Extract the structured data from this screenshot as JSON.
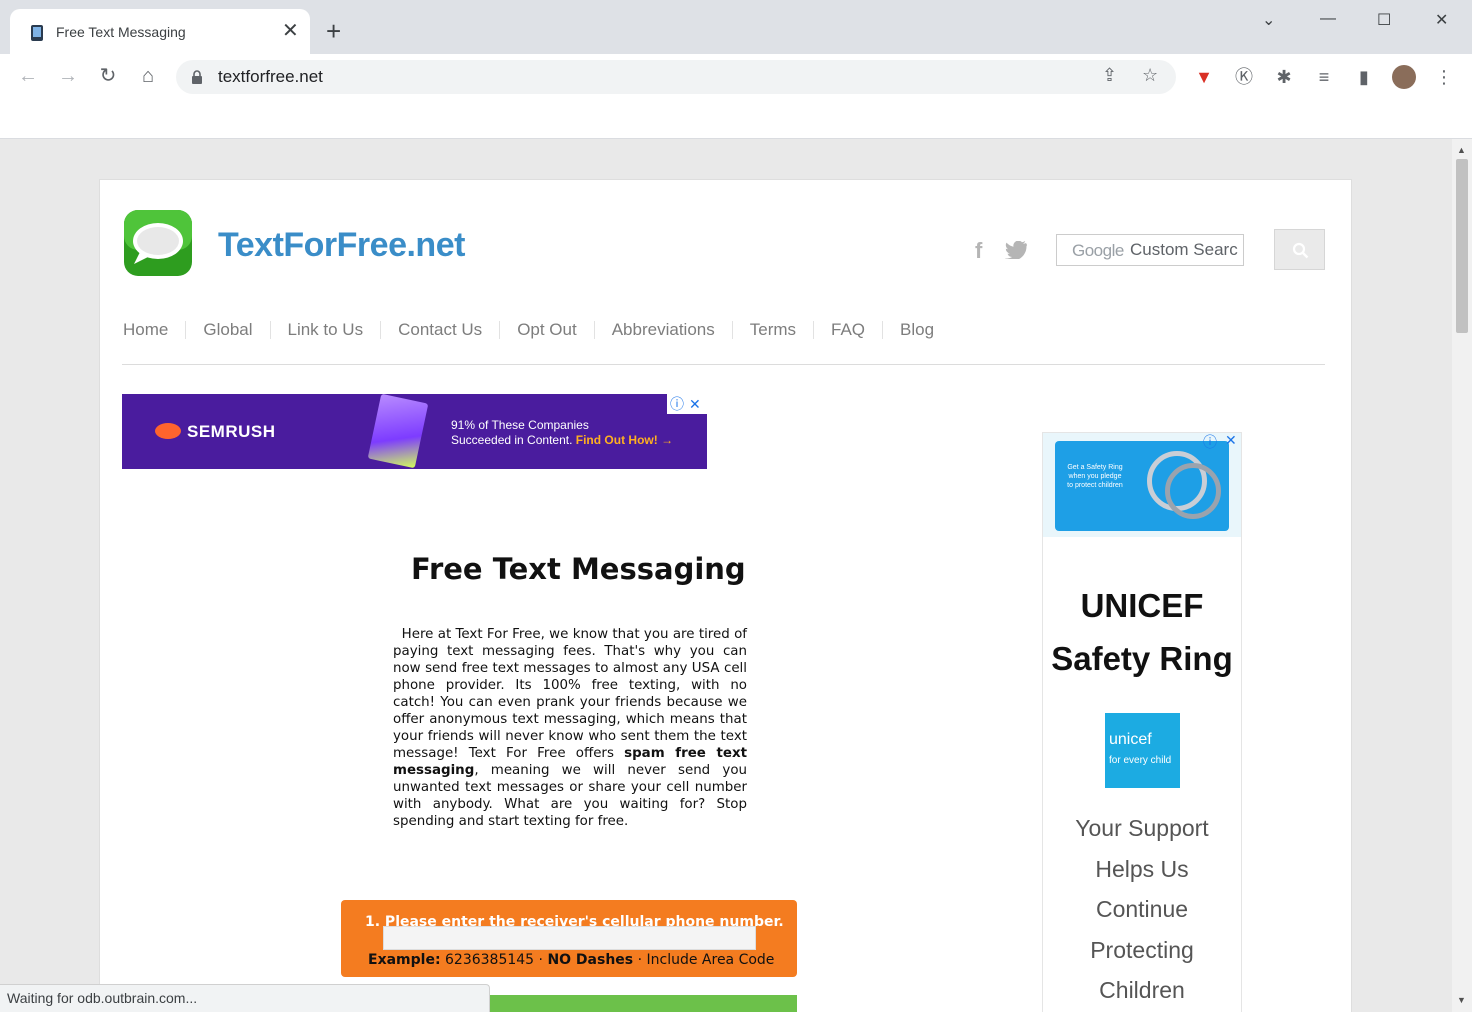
{
  "browser": {
    "tab_title": "Free Text Messaging",
    "url": "textforfree.net",
    "status_text": "Waiting for odb.outbrain.com..."
  },
  "header": {
    "site_title": "TextForFree.net",
    "search_placeholder": "Custom Searc",
    "google_label": "Google"
  },
  "nav": {
    "items": [
      {
        "label": "Home"
      },
      {
        "label": "Global"
      },
      {
        "label": "Link to Us"
      },
      {
        "label": "Contact Us"
      },
      {
        "label": "Opt Out"
      },
      {
        "label": "Abbreviations"
      },
      {
        "label": "Terms"
      },
      {
        "label": "FAQ"
      },
      {
        "label": "Blog"
      }
    ]
  },
  "ad_banner": {
    "brand": "SEMRUSH",
    "line1": "91% of These Companies",
    "line2": "Succeeded in Content.",
    "cta": "Find Out How! →"
  },
  "main": {
    "headline": "Free Text Messaging",
    "intro_part1": "Here at Text For Free, we know that you are tired of paying text messaging fees. That's why you can now send free text messages to almost any USA cell phone provider. Its 100% free texting, with no catch! You can even prank your friends because we offer anonymous text messaging, which means that your friends will never know who sent them the text message! Text For Free offers ",
    "intro_bold": "spam free text messaging",
    "intro_part2": ", meaning we will never send you unwanted text messages or share your cell number with anybody. What are you waiting for? Stop spending and start texting for free."
  },
  "form": {
    "step_label": "1. Please enter the receiver's cellular phone number.",
    "example_label": "Example:",
    "example_value": "6236385145",
    "no_dashes": "NO Dashes",
    "area_code": "Include Area Code",
    "separator": "·"
  },
  "side_ad": {
    "card_text": "Get a Safety Ring when you pledge to protect children",
    "title_line1": "UNICEF",
    "title_line2": "Safety Ring",
    "logo_name": "unicef",
    "logo_tagline": "for every child",
    "support_lines": [
      "Your Support",
      "Helps Us",
      "Continue",
      "Protecting",
      "Children"
    ]
  },
  "colors": {
    "site_title": "#3a8dc8",
    "form_orange": "#f47c20",
    "ad_purple": "#4a1c9e",
    "unicef_blue": "#1cabe2"
  }
}
